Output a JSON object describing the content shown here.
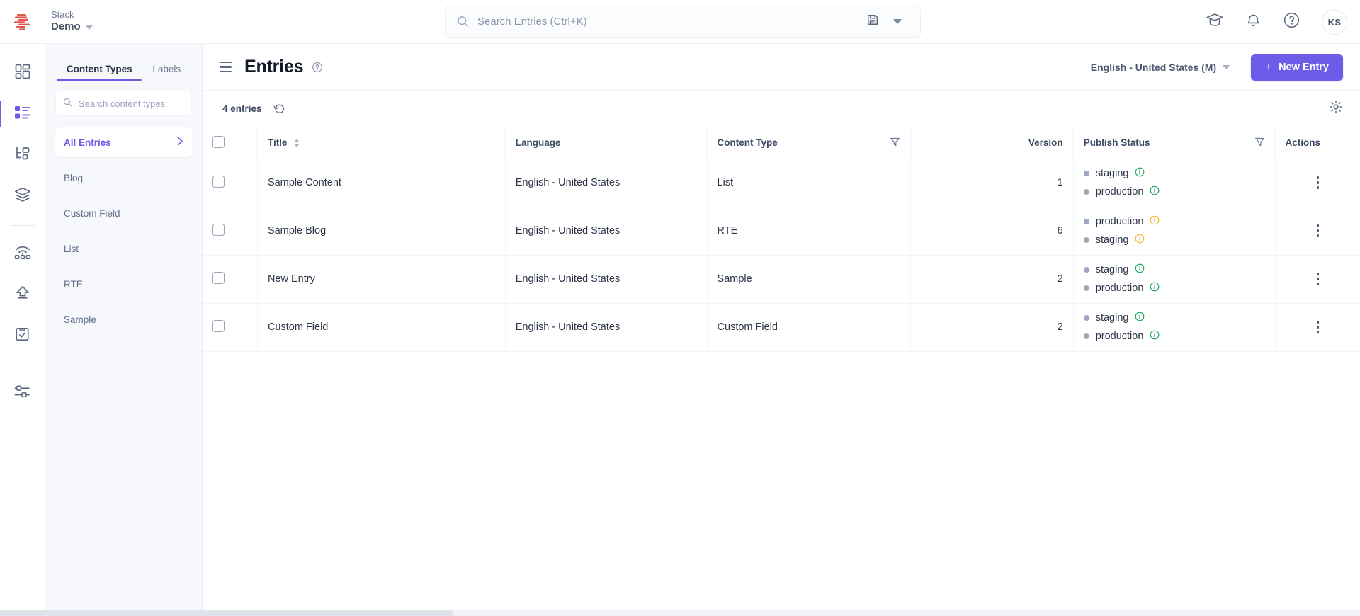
{
  "topbar": {
    "logo_icon": "contentstack-logo-icon",
    "stack_label": "Stack",
    "stack_name": "Demo",
    "search": {
      "icon": "search-icon",
      "placeholder": "Search Entries (Ctrl+K)",
      "save_icon": "save-floppy-icon",
      "dropdown_icon": "chevron-down-icon"
    },
    "actions": [
      {
        "name": "academy-graduation-cap-icon"
      },
      {
        "name": "notifications-bell-icon"
      },
      {
        "name": "help-question-icon"
      }
    ],
    "avatar_initials": "KS"
  },
  "rail": {
    "items": [
      {
        "name": "sidebar-item-dashboard",
        "icon": "dashboard-grid-icon",
        "active": false
      },
      {
        "name": "sidebar-item-entries",
        "icon": "entries-list-icon",
        "active": true
      },
      {
        "name": "sidebar-item-content-types",
        "icon": "content-model-icon",
        "active": false
      },
      {
        "name": "sidebar-item-assets",
        "icon": "layers-stack-icon",
        "active": false
      },
      {
        "name": "sidebar-item-live-preview",
        "icon": "broadcast-wifi-icon",
        "active": false
      },
      {
        "name": "sidebar-item-releases",
        "icon": "upload-arrow-icon",
        "active": false
      },
      {
        "name": "sidebar-item-workflows",
        "icon": "clipboard-check-icon",
        "active": false
      },
      {
        "name": "sidebar-item-settings",
        "icon": "sliders-settings-icon",
        "active": false
      }
    ]
  },
  "content_panel": {
    "tabs": [
      {
        "label": "Content Types",
        "active": true
      },
      {
        "label": "Labels",
        "active": false
      }
    ],
    "search_placeholder": "Search content types",
    "search_icon": "search-icon",
    "items": [
      {
        "label": "All Entries",
        "selected": true,
        "chevron": "chevron-right-icon"
      },
      {
        "label": "Blog",
        "selected": false
      },
      {
        "label": "Custom Field",
        "selected": false
      },
      {
        "label": "List",
        "selected": false
      },
      {
        "label": "RTE",
        "selected": false
      },
      {
        "label": "Sample",
        "selected": false
      }
    ]
  },
  "page_header": {
    "menu_icon": "hamburger-menu-icon",
    "title": "Entries",
    "help_icon": "help-question-icon",
    "language_selector": "English - United States (M)",
    "language_caret": "chevron-down-icon",
    "new_entry_label": "New Entry",
    "new_entry_plus": "+"
  },
  "toolbar": {
    "entries_count": "4 entries",
    "refresh_icon": "refresh-undo-icon",
    "settings_icon": "gear-icon"
  },
  "table": {
    "columns": [
      {
        "key": "checkbox",
        "label": "",
        "name": "select-all-checkbox"
      },
      {
        "key": "title",
        "label": "Title",
        "sortable": true
      },
      {
        "key": "language",
        "label": "Language"
      },
      {
        "key": "content_type",
        "label": "Content Type",
        "filter": true
      },
      {
        "key": "version",
        "label": "Version",
        "align": "right"
      },
      {
        "key": "publish_status",
        "label": "Publish Status",
        "filter": true
      },
      {
        "key": "actions",
        "label": "Actions"
      }
    ],
    "rows": [
      {
        "title": "Sample Content",
        "language": "English - United States",
        "content_type": "List",
        "version": "1",
        "publish_status": [
          {
            "env": "staging",
            "info_color": "#18a15c"
          },
          {
            "env": "production",
            "info_color": "#18a15c"
          }
        ]
      },
      {
        "title": "Sample Blog",
        "language": "English - United States",
        "content_type": "RTE",
        "version": "6",
        "publish_status": [
          {
            "env": "production",
            "info_color": "#f5b335"
          },
          {
            "env": "staging",
            "info_color": "#f5b335"
          }
        ]
      },
      {
        "title": "New Entry",
        "language": "English - United States",
        "content_type": "Sample",
        "version": "2",
        "publish_status": [
          {
            "env": "staging",
            "info_color": "#18a15c"
          },
          {
            "env": "production",
            "info_color": "#18a15c"
          }
        ]
      },
      {
        "title": "Custom Field",
        "language": "English - United States",
        "content_type": "Custom Field",
        "version": "2",
        "publish_status": [
          {
            "env": "staging",
            "info_color": "#18a15c"
          },
          {
            "env": "production",
            "info_color": "#18a15c"
          }
        ]
      }
    ],
    "row_menu_icon": "more-vertical-icon"
  },
  "colors": {
    "accent": "#6c5ce7",
    "panel_bg": "#f6f8fc",
    "text": "#2c3648",
    "muted": "#6c7993",
    "status_ok": "#18a15c",
    "status_warn": "#f5b335",
    "logo_red": "#e4554a"
  }
}
